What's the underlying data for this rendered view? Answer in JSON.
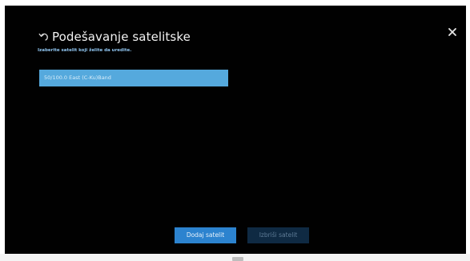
{
  "header": {
    "title": "Podešavanje satelitske",
    "subtitle": "Izaberite satelit koji želite da uredite."
  },
  "satellites": [
    {
      "label": "50/100.0 East (C-Ku)Band"
    }
  ],
  "footer": {
    "add_label": "Dodaj satelit",
    "delete_label": "Izbriši satelit"
  },
  "colors": {
    "screen_background": "#010101",
    "selected_item": "#55a9dd",
    "primary_button": "#2c83cf",
    "disabled_button": "#0f2a43",
    "subtitle_text": "#8fc4ef"
  },
  "icons": {
    "back": "back-arrow-icon",
    "close": "close-icon"
  }
}
